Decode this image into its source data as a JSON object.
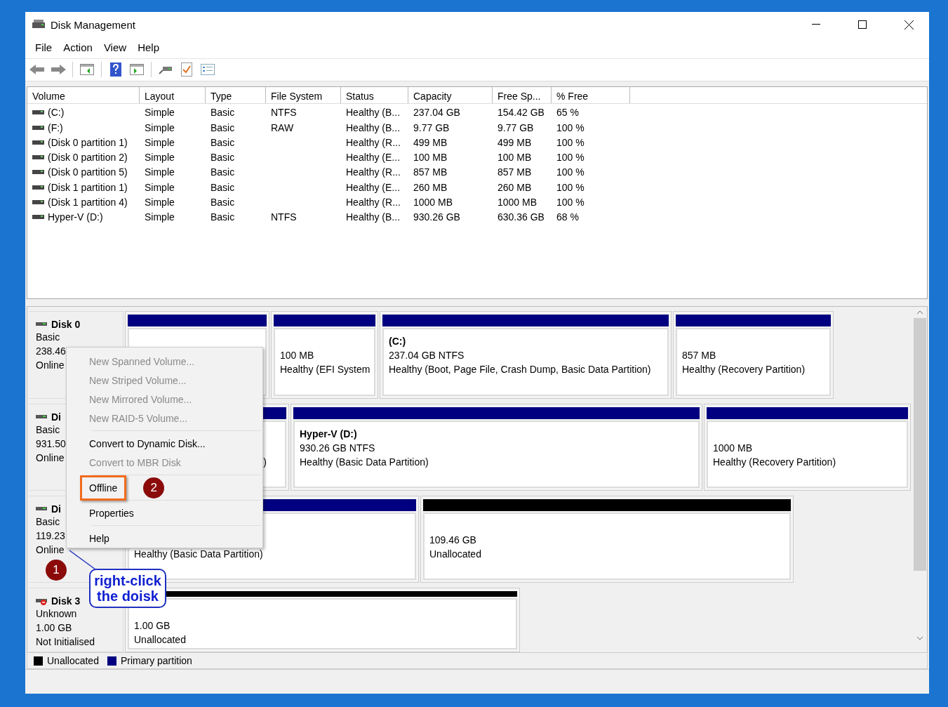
{
  "window": {
    "title": "Disk Management"
  },
  "menu_bar": [
    "File",
    "Action",
    "View",
    "Help"
  ],
  "volume_list": {
    "columns": [
      "Volume",
      "Layout",
      "Type",
      "File System",
      "Status",
      "Capacity",
      "Free Sp...",
      "% Free"
    ],
    "rows": [
      [
        "(C:)",
        "Simple",
        "Basic",
        "NTFS",
        "Healthy (B...",
        "237.04 GB",
        "154.42 GB",
        "65 %"
      ],
      [
        "(F:)",
        "Simple",
        "Basic",
        "RAW",
        "Healthy (B...",
        "9.77 GB",
        "9.77 GB",
        "100 %"
      ],
      [
        "(Disk 0 partition 1)",
        "Simple",
        "Basic",
        "",
        "Healthy (R...",
        "499 MB",
        "499 MB",
        "100 %"
      ],
      [
        "(Disk 0 partition 2)",
        "Simple",
        "Basic",
        "",
        "Healthy (E...",
        "100 MB",
        "100 MB",
        "100 %"
      ],
      [
        "(Disk 0 partition 5)",
        "Simple",
        "Basic",
        "",
        "Healthy (R...",
        "857 MB",
        "857 MB",
        "100 %"
      ],
      [
        "(Disk 1 partition 1)",
        "Simple",
        "Basic",
        "",
        "Healthy (E...",
        "260 MB",
        "260 MB",
        "100 %"
      ],
      [
        "(Disk 1 partition 4)",
        "Simple",
        "Basic",
        "",
        "Healthy (R...",
        "1000 MB",
        "1000 MB",
        "100 %"
      ],
      [
        "Hyper-V (D:)",
        "Simple",
        "Basic",
        "NTFS",
        "Healthy (B...",
        "930.26 GB",
        "630.36 GB",
        "68 %"
      ]
    ]
  },
  "disks": [
    {
      "kind": "online",
      "name": "Disk 0",
      "type": "Basic",
      "size": "238.46",
      "status": "Online",
      "partitions": [
        {
          "kind": "primary"
        },
        {
          "kind": "primary",
          "size": "100 MB",
          "status": "Healthy (EFI System"
        },
        {
          "kind": "primary",
          "name": "(C:)",
          "size": "237.04 GB NTFS",
          "status": "Healthy (Boot, Page File, Crash Dump, Basic Data Partition)"
        },
        {
          "kind": "primary",
          "size": "857 MB",
          "status": "Healthy (Recovery Partition)"
        }
      ]
    },
    {
      "kind": "online",
      "name": "Di",
      "type": "Basic",
      "size": "931.50",
      "status": "Online",
      "partitions": [
        {
          "kind": "primary",
          "status": ")"
        },
        {
          "kind": "primary",
          "name": "Hyper-V  (D:)",
          "size": "930.26 GB NTFS",
          "status": "Healthy (Basic Data Partition)"
        },
        {
          "kind": "primary",
          "size": "1000 MB",
          "status": "Healthy (Recovery Partition)"
        }
      ]
    },
    {
      "kind": "online",
      "name": "Di",
      "type": "Basic",
      "size": "119.23",
      "status": "Online",
      "partitions": [
        {
          "kind": "primary",
          "status": "Healthy (Basic Data Partition)"
        },
        {
          "kind": "unallocated",
          "size": "109.46 GB",
          "status": "Unallocated"
        }
      ]
    },
    {
      "kind": "uninitialized",
      "name": "Disk 3",
      "type": "Unknown",
      "size": "1.00 GB",
      "status": "Not Initialised",
      "partitions": [
        {
          "kind": "unallocated",
          "size": "1.00 GB",
          "status": "Unallocated"
        }
      ]
    }
  ],
  "context_menu": {
    "groups": [
      [
        {
          "label": "New Spanned Volume...",
          "disabled": true,
          "outlined": false
        },
        {
          "label": "New Striped Volume...",
          "disabled": true,
          "outlined": false
        },
        {
          "label": "New Mirrored Volume...",
          "disabled": true,
          "outlined": false
        },
        {
          "label": "New RAID-5 Volume...",
          "disabled": true,
          "outlined": false
        }
      ],
      [
        {
          "label": "Convert to Dynamic Disk...",
          "disabled": false,
          "outlined": false
        },
        {
          "label": "Convert to MBR Disk",
          "disabled": true,
          "outlined": false
        }
      ],
      [
        {
          "label": "Offline",
          "disabled": false,
          "outlined": true,
          "badge": "2"
        }
      ],
      [
        {
          "label": "Properties",
          "disabled": false,
          "outlined": false
        }
      ],
      [
        {
          "label": "Help",
          "disabled": false,
          "outlined": false
        }
      ]
    ]
  },
  "annotation": {
    "badge": "1",
    "callout": "right-click the doisk"
  },
  "legend": [
    {
      "label": "Unallocated",
      "color": "#000000"
    },
    {
      "label": "Primary partition",
      "color": "#000080"
    }
  ]
}
